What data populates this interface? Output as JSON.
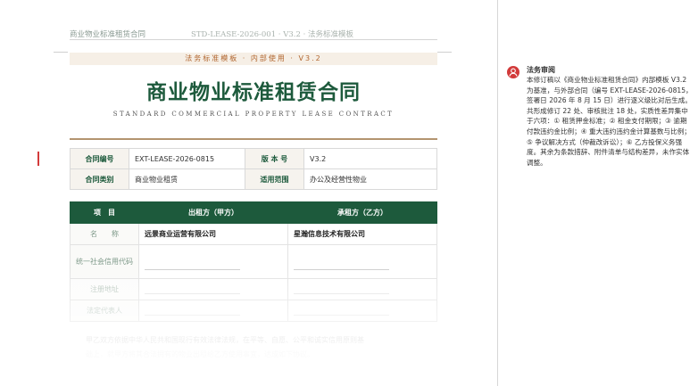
{
  "header": {
    "doc_title": "商业物业标准租赁合同",
    "doc_meta": "STD-LEASE-2026-001 · V3.2 · 法务标准模板"
  },
  "banner": "法务标准模板 · 内部使用 · V3.2",
  "title": "商业物业标准租赁合同",
  "subtitle": "STANDARD COMMERCIAL PROPERTY LEASE CONTRACT",
  "meta": {
    "contract_no_label": "合同编号",
    "contract_no": "EXT-LEASE-2026-0815",
    "version_label": "版 本 号",
    "version": "V3.2",
    "category_label": "合同类别",
    "category": "商业物业租赁",
    "scope_label": "适用范围",
    "scope": "办公及经营性物业"
  },
  "parties": {
    "headers": [
      "项　目",
      "出租方（甲方）",
      "承租方（乙方）"
    ],
    "rows": {
      "name_label": "名　　称",
      "lessor_name": "远景商业运营有限公司",
      "lessee_name": "星瀚信息技术有限公司",
      "credit_code_label": "统一社会信用代码",
      "address_label": "注册地址",
      "rep_label": "法定代表人"
    }
  },
  "body_preview": {
    "line1": "甲乙双方依据中华人民共和国现行有效法律法规，在平等、自愿、公平和诚实信用原则基",
    "line2": "础上，就甲方将其合法拥有的物业出租给乙方使用事宜，达成如下协议。"
  },
  "comment": {
    "author": "法务审阅",
    "body": "本修订稿以《商业物业标准租赁合同》内部模板 V3.2 为基准，与外部合同（编号 EXT-LEASE-2026-0815，签署日 2026 年 8 月 15 日）进行逐义级比对后生成。共形成修订 22 处、审核批注 18 处，实质性差异集中于六项：① 租赁押金标准；② 租金支付期限；③ 逾期付款违约金比例；④ 重大违约违约金计算基数与比例；⑤ 争议解决方式（仲裁改诉讼）；⑥ 乙方投保义务强度。其余为条款措辞、附件清单与结构差异，未作实体调整。"
  },
  "colors": {
    "brand_green": "#1d5a3c",
    "banner_orange": "#b1662f",
    "comment_red": "#d23a3a"
  }
}
